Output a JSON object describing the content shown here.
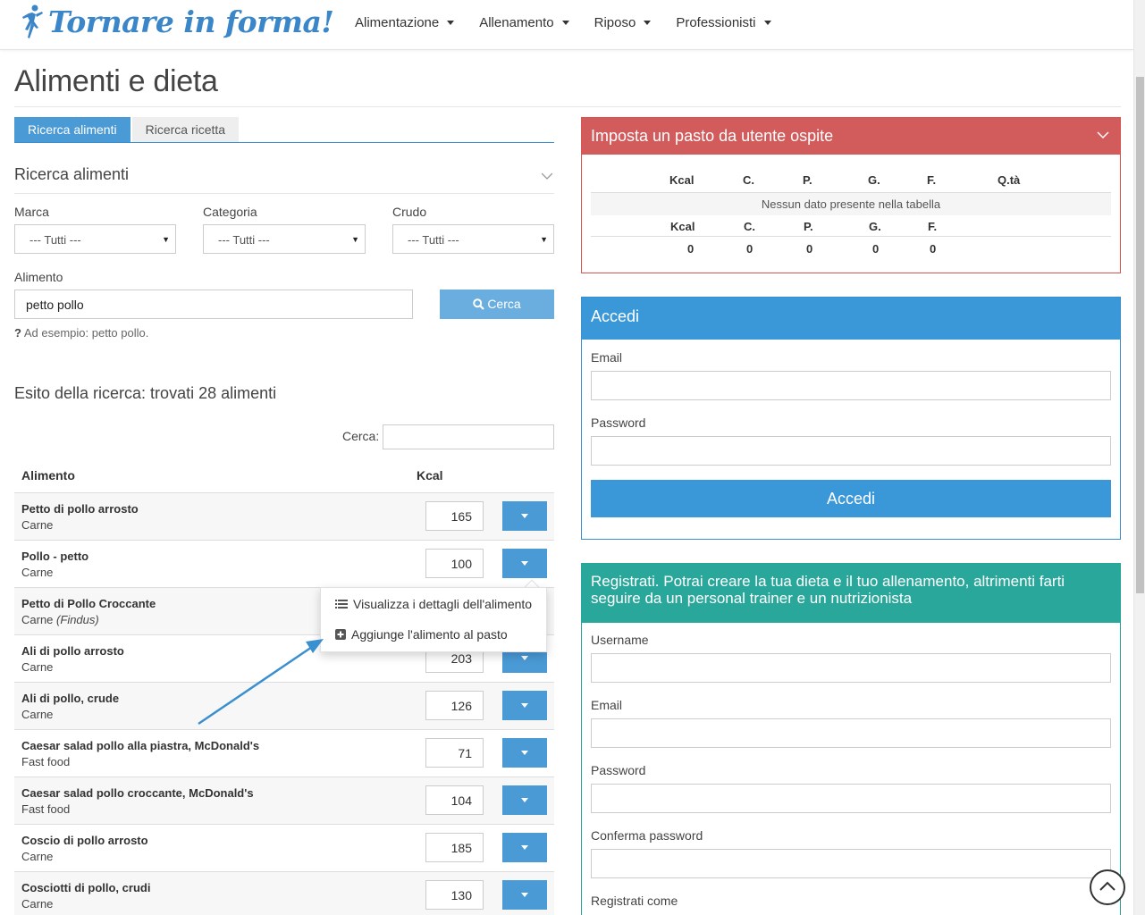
{
  "brand": {
    "name": "Tornare in forma!"
  },
  "nav": [
    {
      "label": "Alimentazione"
    },
    {
      "label": "Allenamento"
    },
    {
      "label": "Riposo"
    },
    {
      "label": "Professionisti"
    }
  ],
  "page_title": "Alimenti e dieta",
  "tabs": [
    {
      "label": "Ricerca alimenti",
      "active": true
    },
    {
      "label": "Ricerca ricetta",
      "active": false
    }
  ],
  "search": {
    "title": "Ricerca alimenti",
    "marca_label": "Marca",
    "marca_value": "--- Tutti ---",
    "categoria_label": "Categoria",
    "categoria_value": "--- Tutti ---",
    "crudo_label": "Crudo",
    "crudo_value": "--- Tutti ---",
    "alimento_label": "Alimento",
    "alimento_value": "petto pollo",
    "button_label": "Cerca",
    "hint_mark": "?",
    "hint": "Ad esempio: petto pollo."
  },
  "results": {
    "title": "Esito della ricerca: trovati 28 alimenti",
    "filter_label": "Cerca:",
    "col_alimento": "Alimento",
    "col_kcal": "Kcal",
    "rows": [
      {
        "name": "Petto di pollo arrosto",
        "category": "Carne",
        "brand": "",
        "kcal": "165"
      },
      {
        "name": "Pollo - petto",
        "category": "Carne",
        "brand": "",
        "kcal": "100"
      },
      {
        "name": "Petto di Pollo Croccante",
        "category": "Carne",
        "brand": "(Findus)",
        "kcal": ""
      },
      {
        "name": "Ali di pollo arrosto",
        "category": "Carne",
        "brand": "",
        "kcal": "203"
      },
      {
        "name": "Ali di pollo, crude",
        "category": "Carne",
        "brand": "",
        "kcal": "126"
      },
      {
        "name": "Caesar salad pollo alla piastra, McDonald's",
        "category": "Fast food",
        "brand": "",
        "kcal": "71"
      },
      {
        "name": "Caesar salad pollo croccante, McDonald's",
        "category": "Fast food",
        "brand": "",
        "kcal": "104"
      },
      {
        "name": "Coscio di pollo arrosto",
        "category": "Carne",
        "brand": "",
        "kcal": "185"
      },
      {
        "name": "Cosciotti di pollo, crudi",
        "category": "Carne",
        "brand": "",
        "kcal": "130"
      }
    ]
  },
  "dropdown_menu": {
    "item_details": "Visualizza i dettagli dell'alimento",
    "item_add": "Aggiunge l'alimento al pasto"
  },
  "meal_panel": {
    "title": "Imposta un pasto da utente ospite",
    "columns": [
      "Kcal",
      "C.",
      "P.",
      "G.",
      "F.",
      "Q.tà"
    ],
    "empty": "Nessun dato presente nella tabella",
    "total_columns": [
      "Kcal",
      "C.",
      "P.",
      "G.",
      "F."
    ],
    "totals": [
      "0",
      "0",
      "0",
      "0",
      "0"
    ]
  },
  "login": {
    "title": "Accedi",
    "email_label": "Email",
    "password_label": "Password",
    "button": "Accedi"
  },
  "register": {
    "title": "Registrati. Potrai creare la tua dieta e il tuo allenamento, altrimenti farti seguire da un personal trainer e un nutrizionista",
    "username_label": "Username",
    "email_label": "Email",
    "password_label": "Password",
    "confirm_label": "Conferma password",
    "role_label": "Registrati come"
  },
  "colors": {
    "brand_blue": "#3a86c8",
    "tab_active": "#4a9ad6",
    "meal_header": "#d25b5b",
    "login_header": "#3a97d8",
    "register_header": "#2aa79b"
  }
}
